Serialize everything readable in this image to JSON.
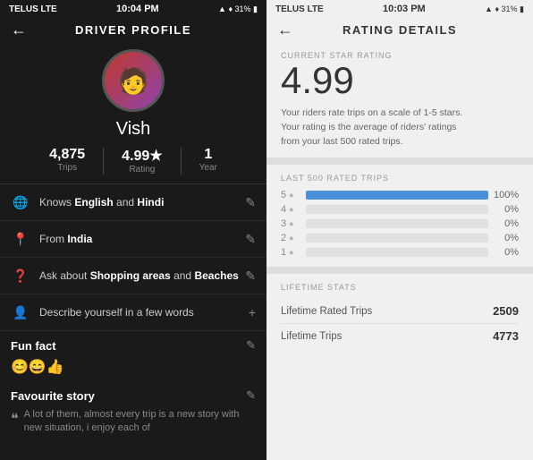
{
  "left": {
    "statusBar": {
      "carrier": "TELUS LTE",
      "time": "10:04 PM",
      "icons": "▲ ♦ 31% ▮"
    },
    "header": {
      "backLabel": "←",
      "title": "DRIVER PROFILE"
    },
    "profile": {
      "name": "Vish",
      "avatarEmoji": "👨",
      "trips": "4,875",
      "tripsLabel": "Trips",
      "rating": "4.99★",
      "ratingLabel": "Rating",
      "year": "1",
      "yearLabel": "Year"
    },
    "infoItems": [
      {
        "icon": "🌐",
        "text": "Knows ",
        "bold1": "English",
        "mid": " and ",
        "bold2": "Hindi",
        "action": "✎"
      },
      {
        "icon": "📍",
        "text": "From ",
        "bold1": "India",
        "mid": "",
        "bold2": "",
        "action": "✎"
      },
      {
        "icon": "❓",
        "text": "Ask about ",
        "bold1": "Shopping areas",
        "mid": " and ",
        "bold2": "Beaches",
        "action": "✎"
      },
      {
        "icon": "👤",
        "text": "Describe yourself in a few words",
        "bold1": "",
        "mid": "",
        "bold2": "",
        "action": "+"
      }
    ],
    "funFact": {
      "title": "Fun fact",
      "editIcon": "✎",
      "emojis": "😊😄👍"
    },
    "favouriteStory": {
      "title": "Favourite story",
      "editIcon": "✎",
      "quoteIcon": "❝",
      "text": "A lot of them, almost every trip is a new story with new situation, i enjoy each of"
    }
  },
  "right": {
    "statusBar": {
      "carrier": "TELUS LTE",
      "time": "10:03 PM",
      "icons": "▲ ♦ 31% ▮"
    },
    "header": {
      "backLabel": "←",
      "title": "RATING DETAILS"
    },
    "currentRating": {
      "label": "CURRENT STAR RATING",
      "value": "4.99",
      "description": "Your riders rate trips on a scale of 1-5 stars.\nYour rating is the average of riders' ratings\nfrom your last 500 rated trips."
    },
    "last500": {
      "label": "LAST 500 RATED TRIPS",
      "bars": [
        {
          "star": "5",
          "pct": 100,
          "display": "100%"
        },
        {
          "star": "4",
          "pct": 0,
          "display": "0%"
        },
        {
          "star": "3",
          "pct": 0,
          "display": "0%"
        },
        {
          "star": "2",
          "pct": 0,
          "display": "0%"
        },
        {
          "star": "1",
          "pct": 0,
          "display": "0%"
        }
      ]
    },
    "lifetimeStats": {
      "label": "LIFETIME STATS",
      "rows": [
        {
          "label": "Lifetime Rated Trips",
          "value": "2509"
        },
        {
          "label": "Lifetime Trips",
          "value": "4773"
        }
      ]
    }
  }
}
